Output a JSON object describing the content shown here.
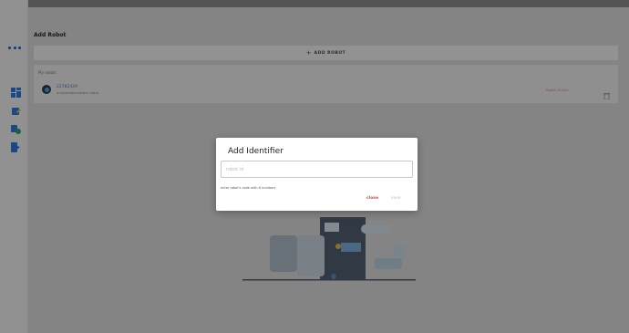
{
  "sidebar": {
    "menu_icon": "more-dots-icon",
    "items": [
      {
        "icon": "dashboard-icon",
        "color": "#2f7be0"
      },
      {
        "icon": "robot-edit-icon",
        "color": "#2f7be0"
      },
      {
        "icon": "robot-settings-icon",
        "color": "#27a55a"
      },
      {
        "icon": "logout-icon",
        "color": "#2f7be0"
      }
    ]
  },
  "main": {
    "page_title": "Add Robot",
    "add_robot_label": "ADD ROBOT",
    "robots_card": {
      "header": "My robots",
      "robots": [
        {
          "id": "22782429",
          "type": "amsterdamrobotic robot",
          "action_label": "Robot Online"
        }
      ]
    }
  },
  "modal": {
    "title": "Add Identifier",
    "input_placeholder": "robot id",
    "input_value": "",
    "helper_text": "enter robot's code with 8 numbers",
    "close_label": "close",
    "save_label": "save"
  },
  "colors": {
    "accent": "#1a5bd6",
    "danger": "#d44a4a",
    "overlay": "rgba(0,0,0,0.40)"
  }
}
